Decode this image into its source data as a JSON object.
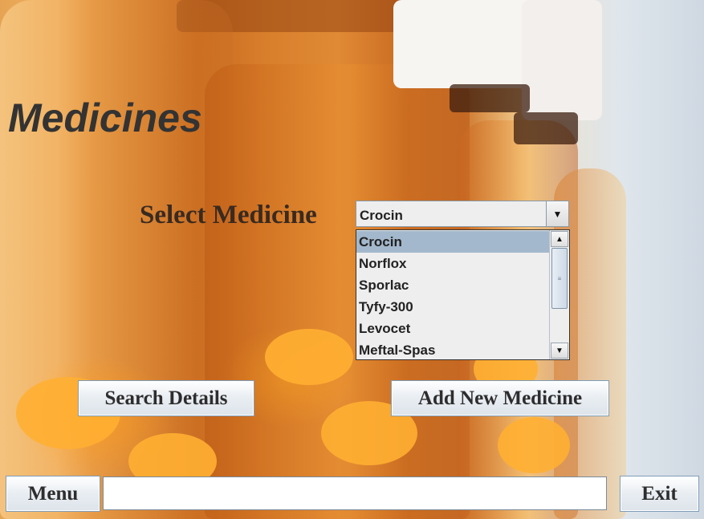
{
  "page": {
    "title": "Medicines"
  },
  "selector": {
    "label": "Select Medicine",
    "selected_value": "Crocin",
    "options": [
      "Crocin",
      "Norflox",
      "Sporlac",
      "Tyfy-300",
      "Levocet",
      "Meftal-Spas"
    ],
    "highlighted_index": 0
  },
  "actions": {
    "search_label": "Search Details",
    "add_label": "Add New Medicine"
  },
  "footer": {
    "menu_label": "Menu",
    "exit_label": "Exit",
    "status_value": ""
  },
  "icons": {
    "dropdown_arrow": "chevron-down-icon",
    "scroll_up": "arrow-up-icon",
    "scroll_down": "arrow-down-icon",
    "scroll_grip": "grip-icon"
  },
  "colors": {
    "list_highlight": "#a3b8cc",
    "button_border": "#7f9db9"
  }
}
